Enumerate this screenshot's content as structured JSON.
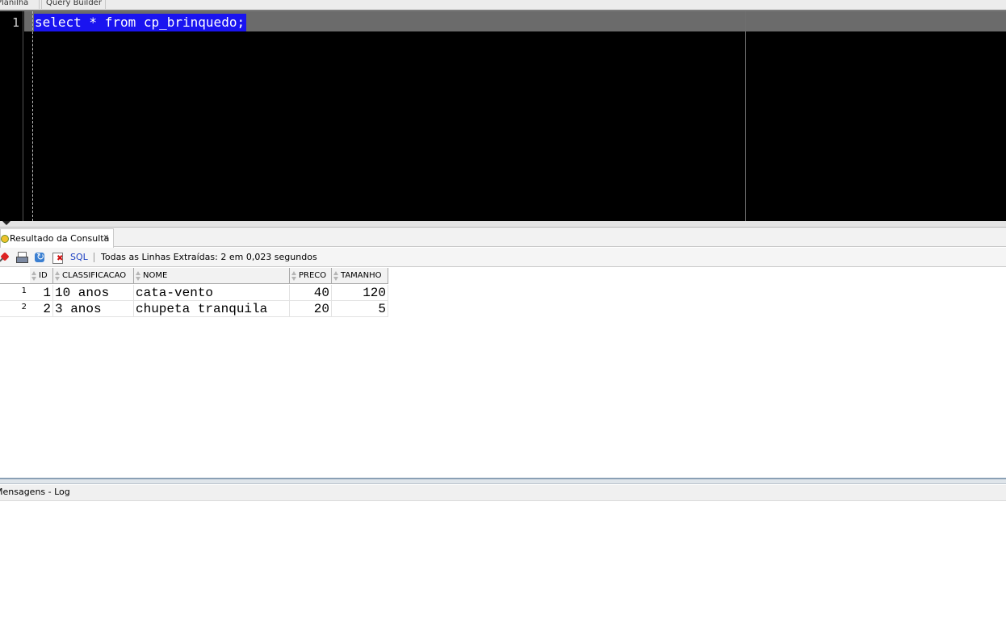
{
  "editor_tabs": [
    "Planilha",
    "Query Builder"
  ],
  "editor": {
    "line_number": "1",
    "code": "select * from cp_brinquedo;"
  },
  "results_tab": {
    "label": "Resultado da Consulta",
    "close": "x"
  },
  "toolbar": {
    "icons": [
      "pin-icon",
      "print-icon",
      "refresh-icon",
      "cancel-icon"
    ],
    "sql_label": "SQL",
    "status": "Todas as Linhas Extraídas: 2 em 0,023 segundos"
  },
  "grid": {
    "columns": [
      "ID",
      "CLASSIFICACAO",
      "NOME",
      "PRECO",
      "TAMANHO"
    ],
    "rows": [
      {
        "num": "1",
        "cells": [
          "1",
          "10 anos",
          "cata-vento",
          "40",
          "120"
        ]
      },
      {
        "num": "2",
        "cells": [
          "2",
          "3 anos",
          "chupeta tranquila",
          "20",
          "5"
        ]
      }
    ]
  },
  "bottom_panel": {
    "tab_label": "Mensagens - Log"
  },
  "colors": {
    "editor_bg": "#000000",
    "selection": "#1a14f0",
    "link": "#1a3fc2"
  }
}
